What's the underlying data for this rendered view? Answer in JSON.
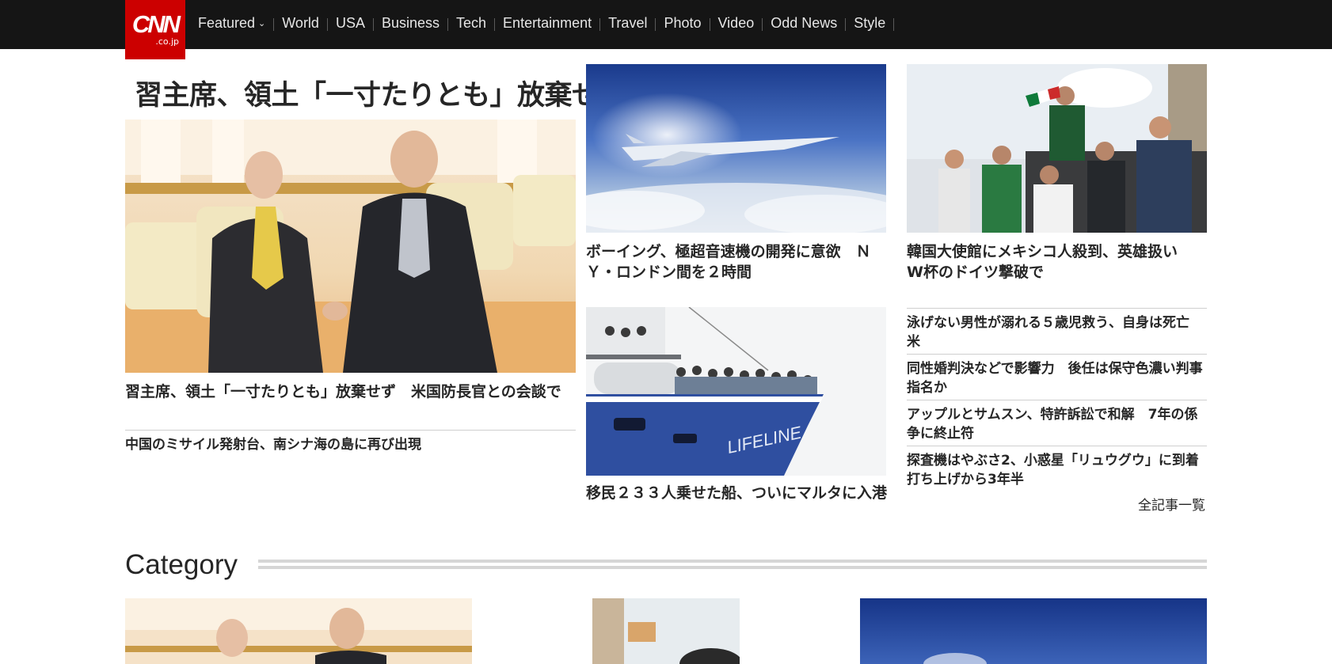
{
  "site": {
    "logo_main": "CNN",
    "logo_sub": ".co.jp"
  },
  "nav": [
    {
      "label": "Featured"
    },
    {
      "label": "World"
    },
    {
      "label": "USA"
    },
    {
      "label": "Business"
    },
    {
      "label": "Tech"
    },
    {
      "label": "Entertainment"
    },
    {
      "label": "Travel"
    },
    {
      "label": "Photo"
    },
    {
      "label": "Video"
    },
    {
      "label": "Odd News"
    },
    {
      "label": "Style"
    }
  ],
  "lead": {
    "big_headline": "習主席、領土「一寸たりとも」放棄せず",
    "title": "習主席、領土「一寸たりとも」放棄せず　米国防長官との会談で",
    "related": "中国のミサイル発射台、南シナ海の島に再び出現"
  },
  "stories": {
    "boeing": "ボーイング、極超音速機の開発に意欲　ＮＹ・ロンドン間を２時間",
    "korea": "韓国大使館にメキシコ人殺到、英雄扱い　W杯のドイツ撃破で",
    "migrants": "移民２３３人乗せた船、ついにマルタに入港"
  },
  "list": [
    "泳げない男性が溺れる５歳児救う、自身は死亡　米",
    "同性婚判決などで影響力　後任は保守色濃い判事指名か",
    "アップルとサムスン、特許訴訟で和解　7年の係争に終止符",
    "探査機はやぶさ2、小惑星「リュウグウ」に到着　打ち上げから3年半"
  ],
  "all_news": "全記事一覧",
  "category": {
    "title": "Category"
  },
  "ship_text": "LIFELINE",
  "colors": {
    "brand": "#cc0000",
    "topbar": "#151515"
  }
}
